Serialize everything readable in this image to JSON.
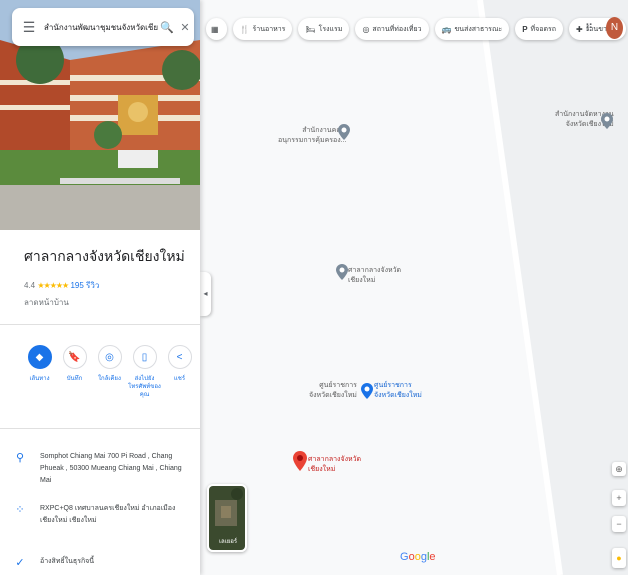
{
  "search": {
    "query": "สำนักงานพัฒนาชุมชนจังหวัดเชียงใหม่",
    "menu_glyph": "☰",
    "search_glyph": "🔍",
    "close_glyph": "✕"
  },
  "place": {
    "title": "ศาลากลางจังหวัดเชียงใหม่",
    "rating": "4.4",
    "stars": "★★★★★",
    "review_count": "195 รีวิว",
    "category": "ลาดหน้าบ้าน"
  },
  "actions": [
    {
      "label": "เส้นทาง",
      "icon": "◆"
    },
    {
      "label": "บันทึก",
      "icon": "🔖"
    },
    {
      "label": "ใกล้เคียง",
      "icon": "◎"
    },
    {
      "label": "ส่งไปยังโทรศัพท์ของคุณ",
      "icon": "▯"
    },
    {
      "label": "แชร์",
      "icon": "<"
    }
  ],
  "info": {
    "address": "Somphot Chiang Mai 700 Pi Road , Chang Phueak , 50300 Mueang Chiang Mai , Chiang Mai",
    "plus_code": "RXPC+Q8 เทศบาลนครเชียงใหม่ อำเภอเมืองเชียงใหม่ เชียงใหม่",
    "claim": "อ้างสิทธิ์ในธุรกิจนี้"
  },
  "chips": [
    {
      "label": "",
      "icon": "▦"
    },
    {
      "label": "ร้านอาหาร",
      "icon": "🍴"
    },
    {
      "label": "โรงแรม",
      "icon": "🛏"
    },
    {
      "label": "สถานที่ท่องเที่ยว",
      "icon": "◎"
    },
    {
      "label": "ขนส่งสาธารณะ",
      "icon": "🚌"
    },
    {
      "label": "ที่จอดรถ",
      "icon": "P"
    },
    {
      "label": "ร้านขายยา",
      "icon": "✚"
    }
  ],
  "user_initial": "N",
  "map": {
    "pois": [
      {
        "text": "สำนักงานคณะ\nอนุกรรมการคุ้มครอง..."
      },
      {
        "text": "สำนักงานจัดหางาน\nจังหวัดเชียงใหม่"
      },
      {
        "text": "ศาลากลางจังหวัด\nเชียงใหม่"
      },
      {
        "text": "ศูนย์ราชการ\nจังหวัดเชียงใหม่"
      },
      {
        "text": "ศูนย์ราชการ\nจังหวัดเชียงใหม่"
      },
      {
        "text": "ศาลากลางจังหวัด\nเชียงใหม่"
      }
    ],
    "thumb_label": "เลเยอร์",
    "logo": "Google",
    "logo_colors": [
      "#4285F4",
      "#EA4335",
      "#FBBC05",
      "#4285F4",
      "#34A853",
      "#EA4335"
    ],
    "accent": "#1a73e8",
    "pin_red": "#ea4335"
  }
}
